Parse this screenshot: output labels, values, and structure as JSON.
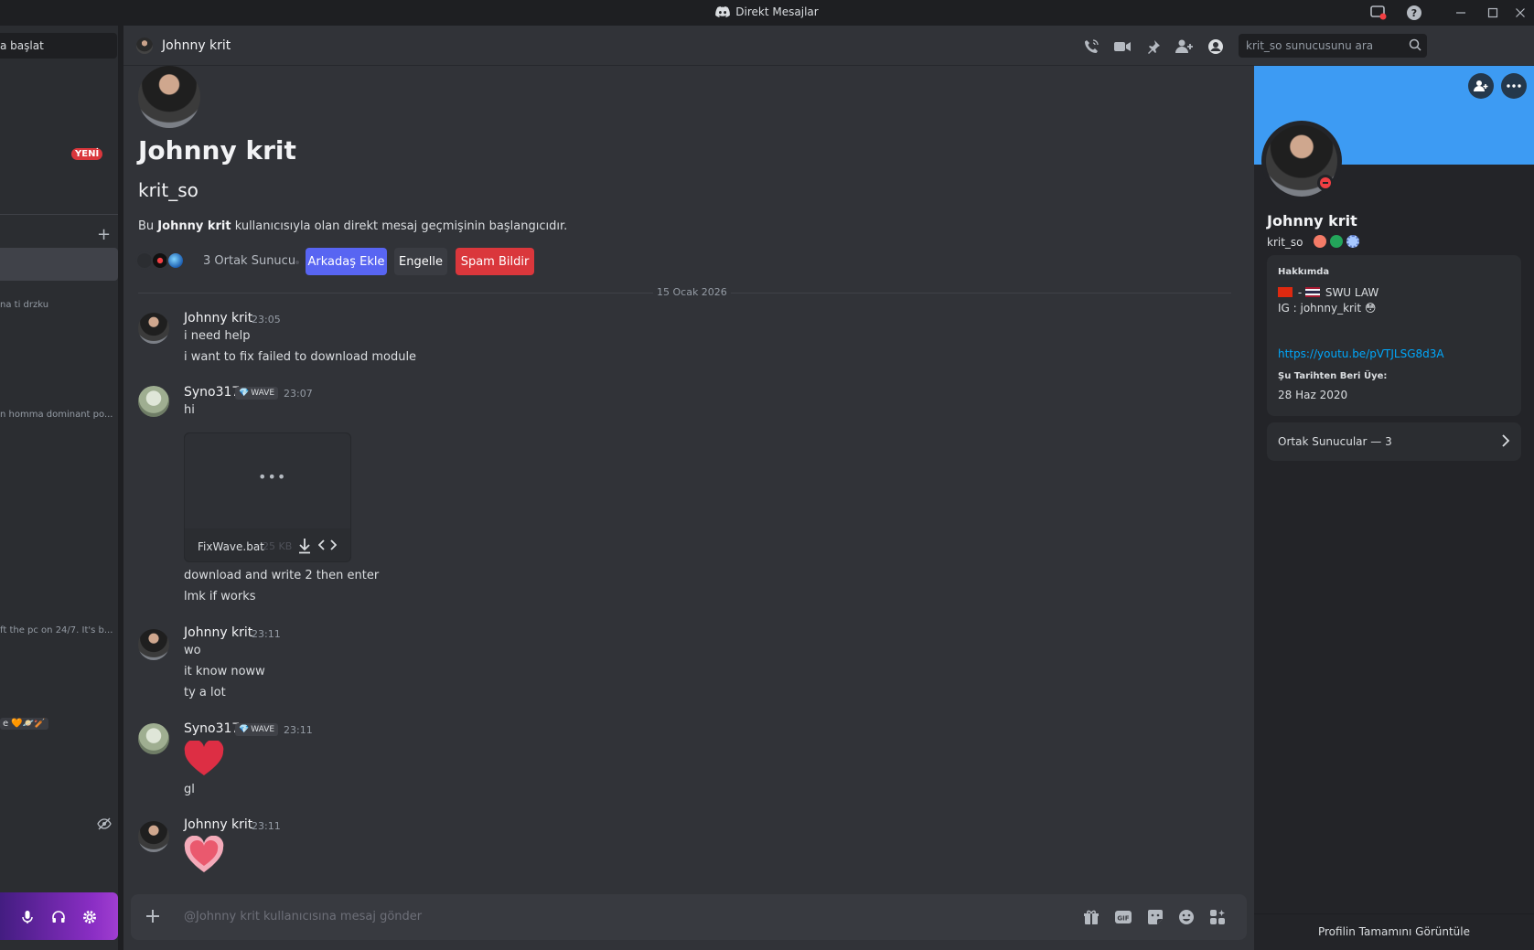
{
  "window": {
    "title": "Direkt Mesajlar"
  },
  "sidebar": {
    "search_text": "a başlat",
    "new_badge": "YENİ",
    "previews": [
      {
        "text": "na ti drzku"
      },
      {
        "text": "n homma dominant po..."
      },
      {
        "text": "ft the pc on 24/7. It's b..."
      }
    ],
    "emoji_status": "e 🧡🪐🏏"
  },
  "header": {
    "user_name": "Johnny krit",
    "search_placeholder": "krit_so sunucusunu ara"
  },
  "intro": {
    "display_name": "Johnny krit",
    "username": "krit_so",
    "desc_prefix": "Bu ",
    "desc_name": "Johnny krit",
    "desc_suffix": " kullanıcısıyla olan direkt mesaj geçmişinin başlangıcıdır.",
    "mutual_servers": "3 Ortak Sunucu",
    "add_friend": "Arkadaş Ekle",
    "block": "Engelle",
    "report_spam": "Spam Bildir"
  },
  "date_divider": "15 Ocak 2026",
  "messages": [
    {
      "author": "Johnny krit",
      "time": "23:05",
      "lines": [
        "i need help",
        "i want to fix failed to download module"
      ]
    },
    {
      "author": "Syno317",
      "tag": "WAVE",
      "time": "23:07",
      "lines": [
        "hi"
      ],
      "attachment": {
        "name": "FixWave.bat",
        "size": "25 KB"
      },
      "after_lines": [
        "download and write 2 then enter",
        "lmk if works"
      ]
    },
    {
      "author": "Johnny krit",
      "time": "23:11",
      "lines": [
        "wo",
        "it know noww",
        "ty a lot"
      ]
    },
    {
      "author": "Syno317",
      "tag": "WAVE",
      "time": "23:11",
      "emoji": "❤️",
      "lines": [
        "gl"
      ]
    },
    {
      "author": "Johnny krit",
      "time": "23:11",
      "emoji": "💗"
    }
  ],
  "composer": {
    "placeholder": "@Johnny krit kullanıcısına mesaj gönder"
  },
  "profile": {
    "display_name": "Johnny krit",
    "username": "krit_so",
    "about_label": "Hakkımda",
    "about_line1": " SWU LAW",
    "about_line2": "IG : johnny_krit",
    "about_emoji": "😳",
    "link": "https://youtu.be/pVTJLSG8d3A",
    "member_since_label": "Şu Tarihten Beri Üye:",
    "member_since": "28 Haz 2020",
    "mutual_servers": "Ortak Sunucular — 3",
    "view_full": "Profilin Tamamını Görüntüle"
  },
  "colors": {
    "accent_blurple": "#5865f2",
    "danger_red": "#da373c",
    "banner_blue": "#3d9bf3",
    "link_blue": "#00a8fc",
    "dnd_red": "#f23f43"
  }
}
